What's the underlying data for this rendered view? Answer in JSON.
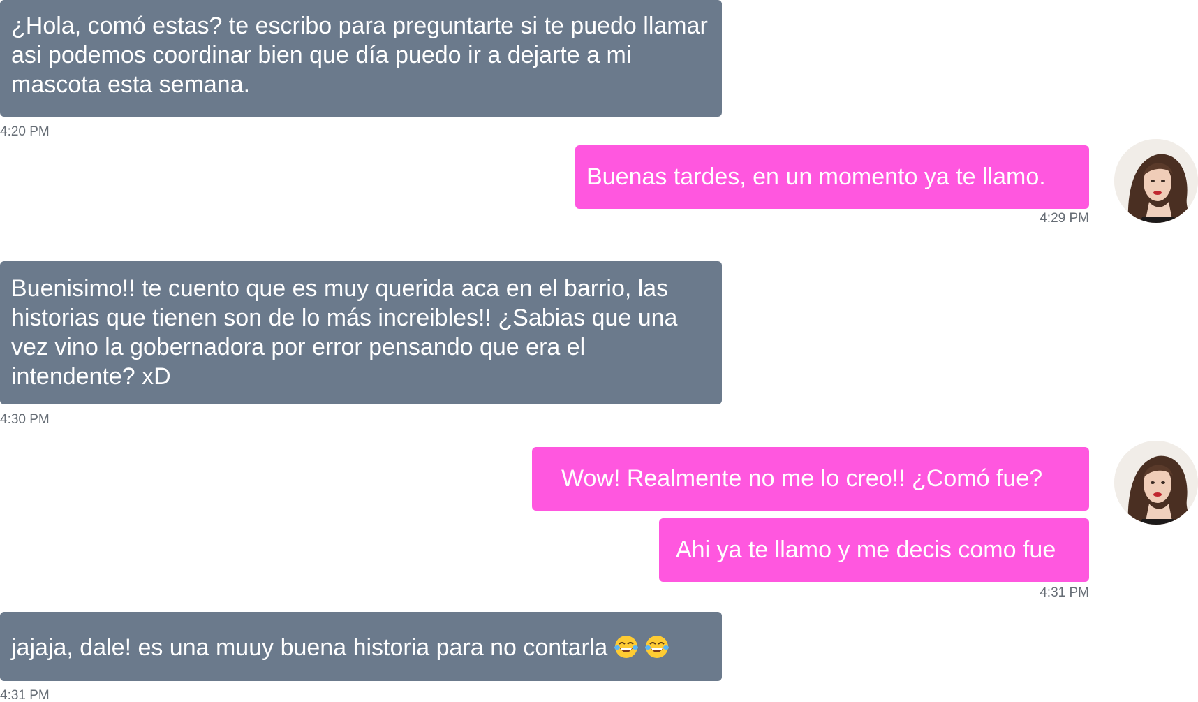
{
  "messages": [
    {
      "direction": "incoming",
      "text": "¿Hola, comó estas? te escribo para preguntarte si te puedo llamar asi podemos coordinar bien que día puedo ir a dejarte a mi mascota esta semana.",
      "time": "4:20 PM"
    },
    {
      "direction": "outgoing",
      "text": "Buenas tardes, en un momento ya te llamo.",
      "time": "4:29 PM"
    },
    {
      "direction": "incoming",
      "text": "Buenisimo!! te cuento que es muy querida aca en el barrio, las historias que tienen son de lo más increibles!! ¿Sabias que una vez vino la gobernadora por error pensando que era el intendente? xD",
      "time": "4:30 PM"
    },
    {
      "direction": "outgoing",
      "text": "Wow!  Realmente no me lo creo!! ¿Comó fue?"
    },
    {
      "direction": "outgoing",
      "text": "Ahi ya te llamo y me decis como fue",
      "time": "4:31 PM"
    },
    {
      "direction": "incoming",
      "text": "jajaja, dale! es una muuy buena historia para no contarla",
      "emoji": [
        "joy-emoji",
        "joy-emoji"
      ],
      "time": "4:31 PM"
    }
  ],
  "colors": {
    "incoming_bubble": "#6b7a8c",
    "outgoing_bubble": "#ff57df",
    "bubble_text": "#ffffff",
    "timestamp": "#666d75"
  },
  "avatar": {
    "icon": "user-avatar-photo"
  }
}
